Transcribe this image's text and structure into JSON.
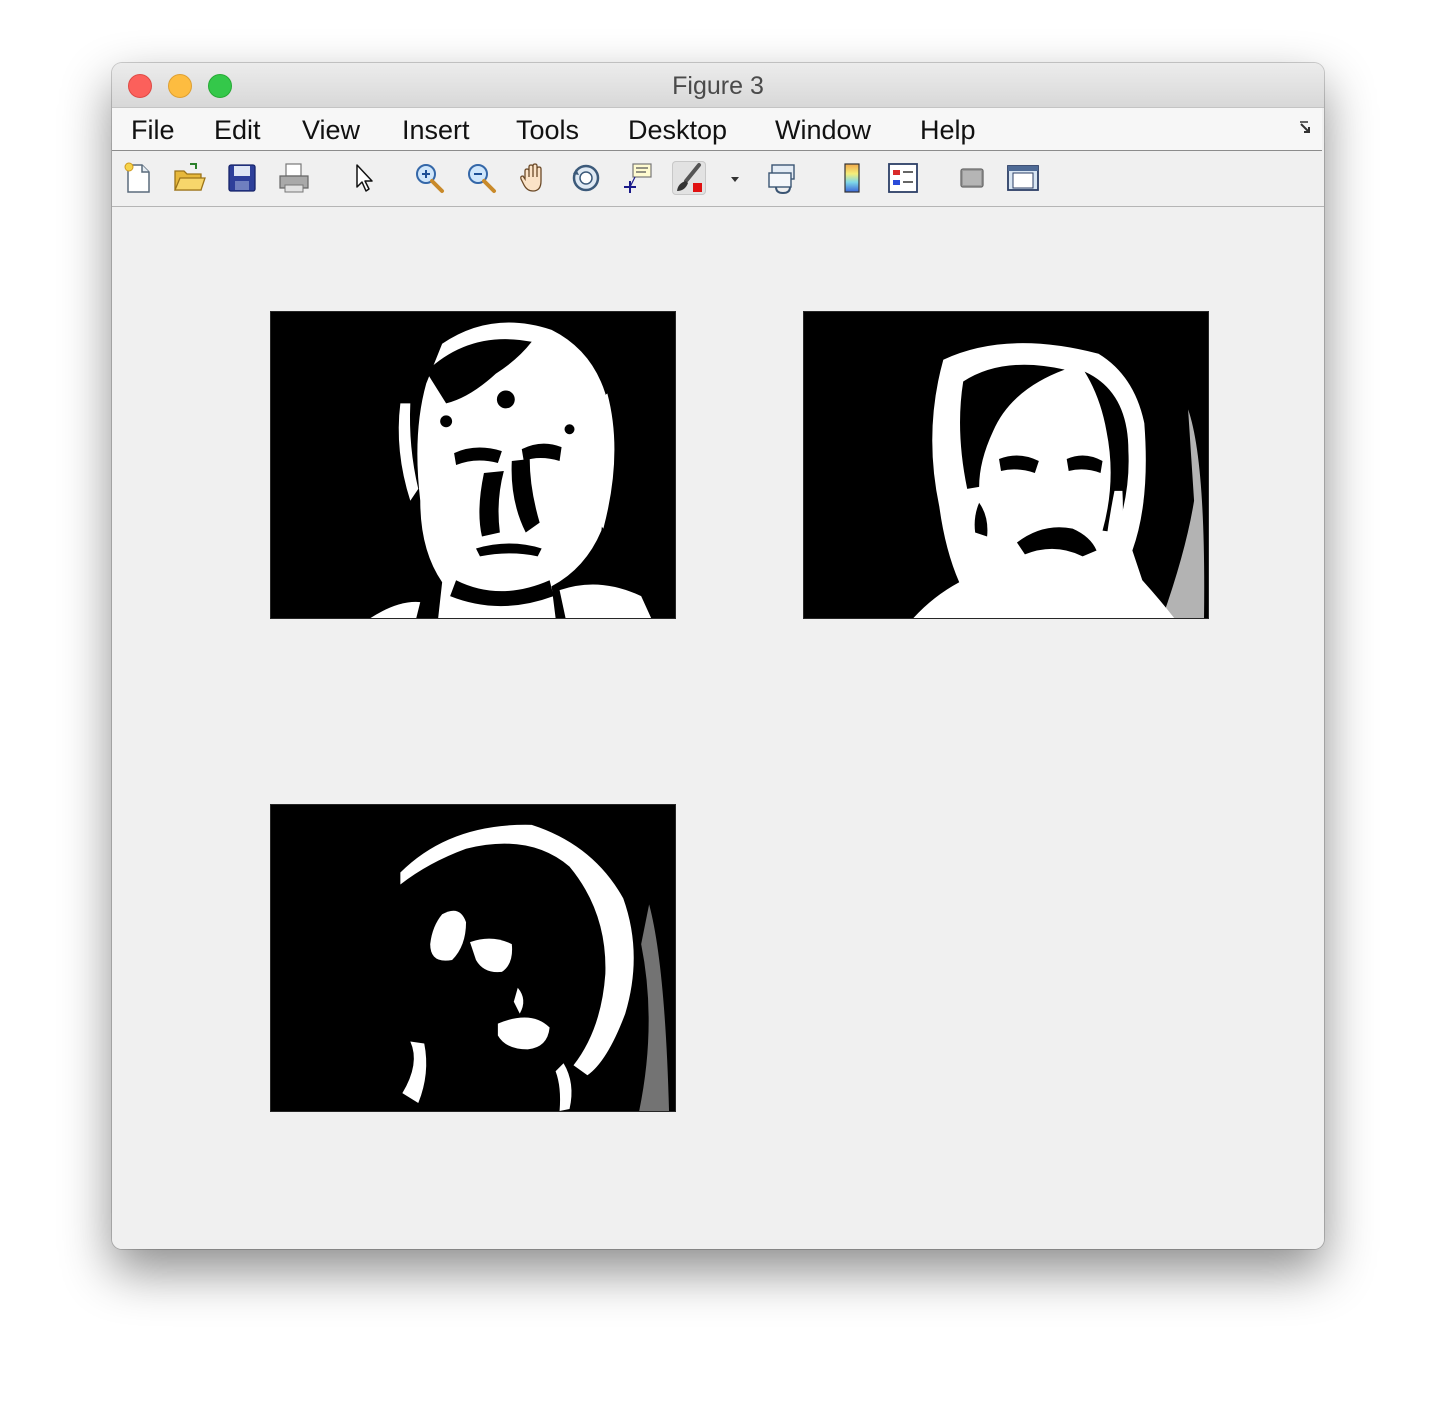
{
  "window": {
    "title": "Figure 3"
  },
  "menubar": {
    "items": [
      {
        "label": "File"
      },
      {
        "label": "Edit"
      },
      {
        "label": "View"
      },
      {
        "label": "Insert"
      },
      {
        "label": "Tools"
      },
      {
        "label": "Desktop"
      },
      {
        "label": "Window"
      },
      {
        "label": "Help"
      }
    ],
    "corner_icon": "dock-arrow-icon"
  },
  "toolbar": {
    "tools": [
      {
        "icon": "new-figure-icon"
      },
      {
        "icon": "open-file-icon"
      },
      {
        "icon": "save-icon"
      },
      {
        "icon": "print-icon"
      },
      {
        "icon": "edit-plot-arrow-icon"
      },
      {
        "icon": "zoom-in-icon"
      },
      {
        "icon": "zoom-out-icon"
      },
      {
        "icon": "pan-hand-icon"
      },
      {
        "icon": "rotate-3d-icon"
      },
      {
        "icon": "data-cursor-icon"
      },
      {
        "icon": "brush-icon"
      },
      {
        "icon": "brush-dropdown-icon"
      },
      {
        "icon": "link-plot-icon"
      },
      {
        "icon": "colorbar-icon"
      },
      {
        "icon": "legend-icon"
      },
      {
        "icon": "hide-plot-tools-icon"
      },
      {
        "icon": "show-plot-tools-icon"
      }
    ]
  },
  "figure": {
    "subplots": [
      {
        "content": "binary thresholded face image (man, frontal)"
      },
      {
        "content": "binary thresholded face image (woman, frontal)"
      },
      {
        "content": "binary thresholded face image (head turned)"
      }
    ],
    "colors": {
      "foreground": "#ffffff",
      "background": "#000000",
      "figure_bg": "#f0f0f0"
    }
  }
}
